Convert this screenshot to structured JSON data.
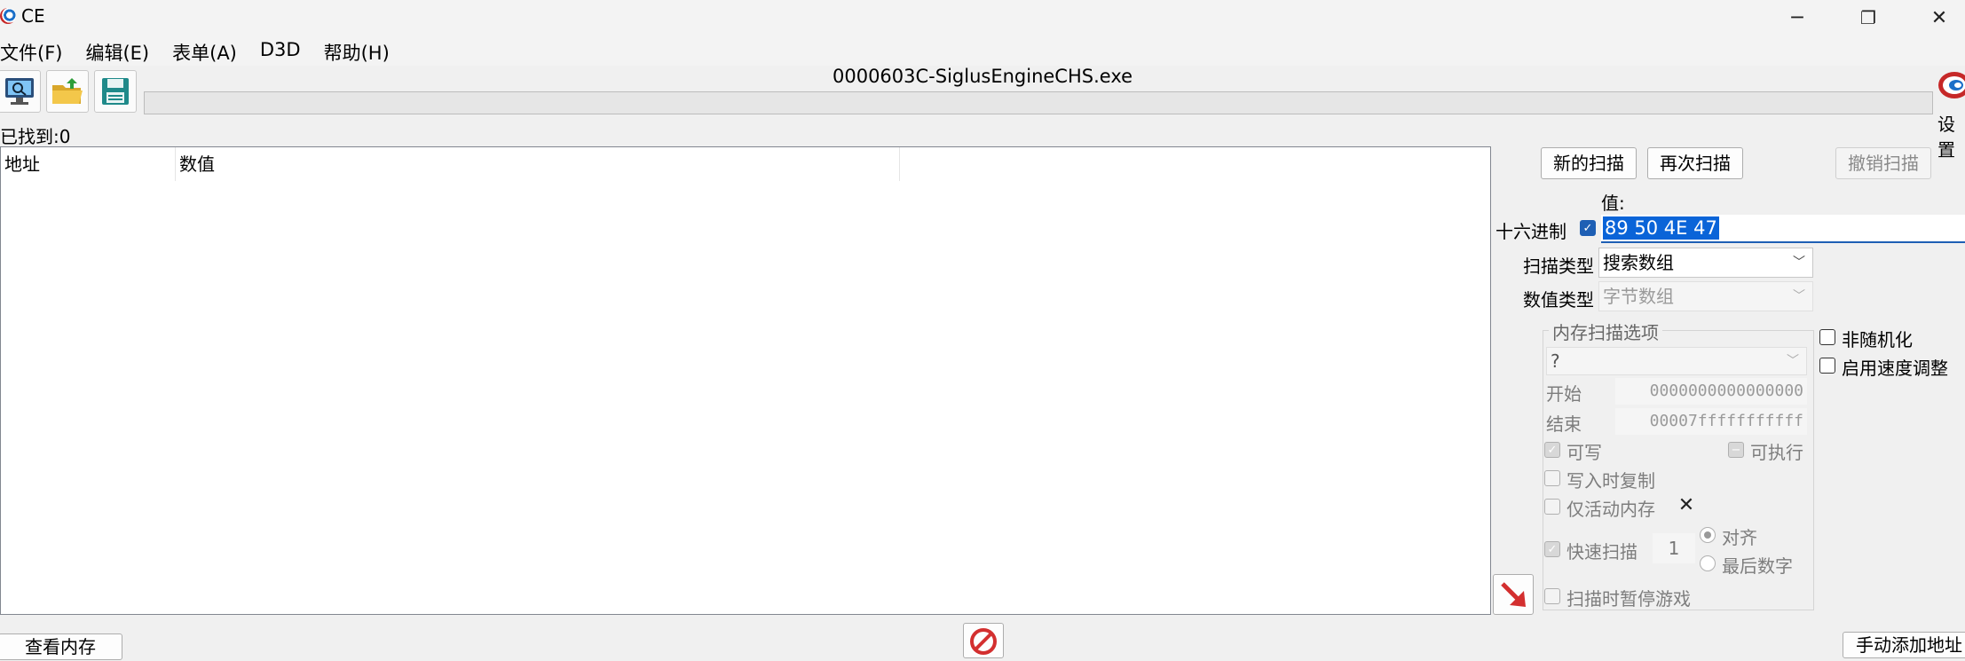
{
  "window": {
    "title": "CE",
    "minimize_icon": "─",
    "maximize_icon": "❐",
    "close_icon": "✕"
  },
  "menu": [
    "文件(F)",
    "编辑(E)",
    "表单(A)",
    "D3D",
    "帮助(H)"
  ],
  "process_title": "0000603C-SiglusEngineCHS.exe",
  "settings_label": "设置",
  "found_label": "已找到:0",
  "columns": {
    "address": "地址",
    "value": "数值"
  },
  "buttons": {
    "new_scan": "新的扫描",
    "next_scan": "再次扫描",
    "undo_scan": "撤销扫描",
    "view_memory": "查看内存",
    "add_address": "手动添加地址"
  },
  "value_section": {
    "label": "值:",
    "hex_label": "十六进制",
    "hex_checked": true,
    "value": "89 50 4E 47"
  },
  "scan_type": {
    "label": "扫描类型",
    "selected": "搜索数组"
  },
  "value_type": {
    "label": "数值类型",
    "selected": "字节数组"
  },
  "options": {
    "unrandomize": "非随机化",
    "speedhack": "启用速度调整"
  },
  "memory_scan": {
    "title": "内存扫描选项",
    "region": "?",
    "start_label": "开始",
    "start_value": "0000000000000000",
    "stop_label": "结束",
    "stop_value": "00007fffffffffff",
    "writable": "可写",
    "executable": "可执行",
    "copy_on_write": "写入时复制",
    "active_memory_only": "仅活动内存",
    "fast_scan": "快速扫描",
    "fast_scan_value": "1",
    "alignment": "对齐",
    "last_digits": "最后数字",
    "pause_game": "扫描时暂停游戏"
  },
  "colors": {
    "selection": "#0a64d8",
    "checkbox": "#1e5fb4",
    "arrow": "#d32f2f"
  }
}
